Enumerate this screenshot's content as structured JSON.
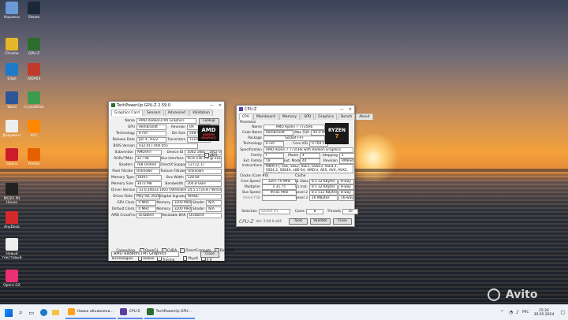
{
  "desktop_icons": [
    {
      "label": "Корзина",
      "color": "#6a9ad6"
    },
    {
      "label": "Steam",
      "color": "#1b2838"
    },
    {
      "label": "Chrome",
      "color": "#e5b62a"
    },
    {
      "label": "GPU-Z",
      "color": "#2a6d2c"
    },
    {
      "label": "Edge",
      "color": "#1d7ac9"
    },
    {
      "label": "AIDA64",
      "color": "#c0392b"
    },
    {
      "label": "Word",
      "color": "#2b579a"
    },
    {
      "label": "CrystalDisk",
      "color": "#3c9b4d"
    },
    {
      "label": "Документ",
      "color": "#eeeeee"
    },
    {
      "label": "VLC",
      "color": "#ff8800"
    },
    {
      "label": "Opera",
      "color": "#cc1b2b"
    },
    {
      "label": "Firefox",
      "color": "#e66000"
    },
    {
      "label": "MOZA Pit House",
      "color": "#222222"
    },
    {
      "label": "AnyDesk",
      "color": "#d52a2a"
    },
    {
      "label": "Новый текстовый",
      "color": "#eeeeee"
    },
    {
      "label": "Opera GX",
      "color": "#ea2f72"
    }
  ],
  "gpuz": {
    "title": "TechPowerUp GPU-Z 2.59.0",
    "tabs": [
      "Graphics Card",
      "Sensors",
      "Advanced",
      "Validation"
    ],
    "logo_text": "AMD",
    "logo_sub": "RADEON GRAPHICS",
    "lookup": "Lookup",
    "uefi": "UEFI",
    "rows": [
      {
        "l": "Name",
        "v": "AMD Radeon(TM) Graphics"
      },
      {
        "l": "GPU",
        "v": "Rembrandt",
        "l2": "Revision",
        "v2": "0A"
      },
      {
        "l": "Technology",
        "v": "6 nm",
        "l2": "Die Size",
        "v2": "208 mm²"
      },
      {
        "l": "Release Date",
        "v": "Jan 4, 2022",
        "l2": "Transistors",
        "v2": "13100M"
      },
      {
        "l": "BIOS Version",
        "v": "032.017.000.055"
      },
      {
        "l": "Subvendor",
        "v": "AMD/ATI",
        "l2": "Device ID",
        "v2": "1002 1681 - 1002 0124"
      },
      {
        "l": "ROPs/TMUs",
        "v": "32 / 48",
        "l2": "Bus Interface",
        "v2": "PCIe x16 4.0 @ x16 4.0"
      },
      {
        "l": "Shaders",
        "v": "768 Unified",
        "l2": "DirectX Support",
        "v2": "12 (12_1)"
      },
      {
        "l": "Pixel Fillrate",
        "v": "Unknown",
        "l2": "Texture Fillrate",
        "v2": "Unknown"
      },
      {
        "l": "Memory Type",
        "v": "DDR5",
        "l2": "Bus Width",
        "v2": "128 bit"
      },
      {
        "l": "Memory Size",
        "v": "3072 MB",
        "l2": "Bandwidth",
        "v2": "204.8 GB/s"
      },
      {
        "l": "Driver Version",
        "v": "31.0.24033.1003 (Adrenalin 24.5.1) DCH / Win10 64"
      },
      {
        "l": "Driver Date",
        "v": "May 08, 2024",
        "l2": "Digital Signature",
        "v2": "WHQL"
      },
      {
        "l": "GPU Clock",
        "v": "0 MHz",
        "l2": "Memory",
        "v2": "3200 MHz",
        "l3": "Shader",
        "v3": "N/A"
      },
      {
        "l": "Default Clock",
        "v": "0 MHz",
        "l2": "Memory",
        "v2": "3200 MHz",
        "l3": "Shader",
        "v3": "N/A"
      },
      {
        "l": "AMD CrossFire",
        "v": "Disabled",
        "l2": "Resizable BAR",
        "v2": "Disabled"
      }
    ],
    "computing_label": "Computing",
    "computing": [
      "OpenCL",
      "CUDA",
      "DirectCompute",
      "DirectML"
    ],
    "technologies_label": "Technologies",
    "technologies": [
      "Vulkan",
      "Ray Tracing",
      "PhysX",
      "OpenGL 4.6"
    ],
    "gpu_select": "AMD Radeon(TM) Graphics",
    "close": "Close"
  },
  "cpuz": {
    "title": "CPU-Z",
    "tabs": [
      "CPU",
      "Mainboard",
      "Memory",
      "SPD",
      "Graphics",
      "Bench",
      "About"
    ],
    "processor_label": "Processor",
    "name_l": "Name",
    "name_v": "AMD Ryzen 7 7735HS",
    "codename_l": "Code Name",
    "codename_v": "Rembrandt",
    "maxtdp_l": "Max TDP",
    "maxtdp_v": "45.0 W",
    "package_l": "Package",
    "package_v": "Socket FP7",
    "tech_l": "Technology",
    "tech_v": "6 nm",
    "vid_l": "Core VID",
    "vid_v": "0.769 V",
    "spec_l": "Specification",
    "spec_v": "AMD Ryzen 7 7735HS with Radeon Graphics",
    "family_l": "Family",
    "family_v": "F",
    "model_l": "Model",
    "model_v": "4",
    "stepping_l": "Stepping",
    "stepping_v": "1",
    "extfam_l": "Ext. Family",
    "extfam_v": "19",
    "extmod_l": "Ext. Model",
    "extmod_v": "44",
    "rev_l": "Revision",
    "rev_v": "RMB-B1",
    "instr_l": "Instructions",
    "instr_v": "MMX(+), SSE, SSE2, SSE3, SSSE3, SSE4.1, SSE4.2, SSE4A, x86-64, AMD-V, AES, AVX, AVX2, FMA3, SHA",
    "clocks_label": "Clocks (Core #0)",
    "corespeed_l": "Core Speed",
    "corespeed_v": "3267.70 MHz",
    "mult_l": "Multiplier",
    "mult_v": "x 31.75",
    "bus_l": "Bus Speed",
    "bus_v": "99.81 MHz",
    "fsb_l": "Rated FSB",
    "fsb_v": "",
    "cache_label": "Cache",
    "l1d_l": "L1 Data",
    "l1d_v": "8 x 32 KBytes",
    "l1d_w": "8-way",
    "l1i_l": "L1 Inst.",
    "l1i_v": "8 x 32 KBytes",
    "l1i_w": "8-way",
    "l2_l": "Level 2",
    "l2_v": "8 x 512 KBytes",
    "l2_w": "8-way",
    "l3_l": "Level 3",
    "l3_v": "16 MBytes",
    "l3_w": "16-way",
    "selection_l": "Selection",
    "selection_v": "Socket #1",
    "cores_l": "Cores",
    "cores_v": "8",
    "threads_l": "Threads",
    "threads_v": "16",
    "brand": "CPU-Z",
    "version": "Ver. 2.09.0.x64",
    "tools": "Tools",
    "validate": "Validate",
    "close": "Close",
    "logo_text": "RYZEN",
    "logo_sub": "7"
  },
  "taskbar": {
    "items": [
      {
        "label": "Новое объявлени...",
        "color": "#ff9f1c"
      },
      {
        "label": "CPU-Z",
        "color": "#5b3fa0"
      },
      {
        "label": "TechPowerUp GPU-...",
        "color": "#2a6d2c"
      }
    ],
    "lang": "РУС",
    "time": "15:24",
    "date": "30.05.2024"
  },
  "watermark": "Avito"
}
